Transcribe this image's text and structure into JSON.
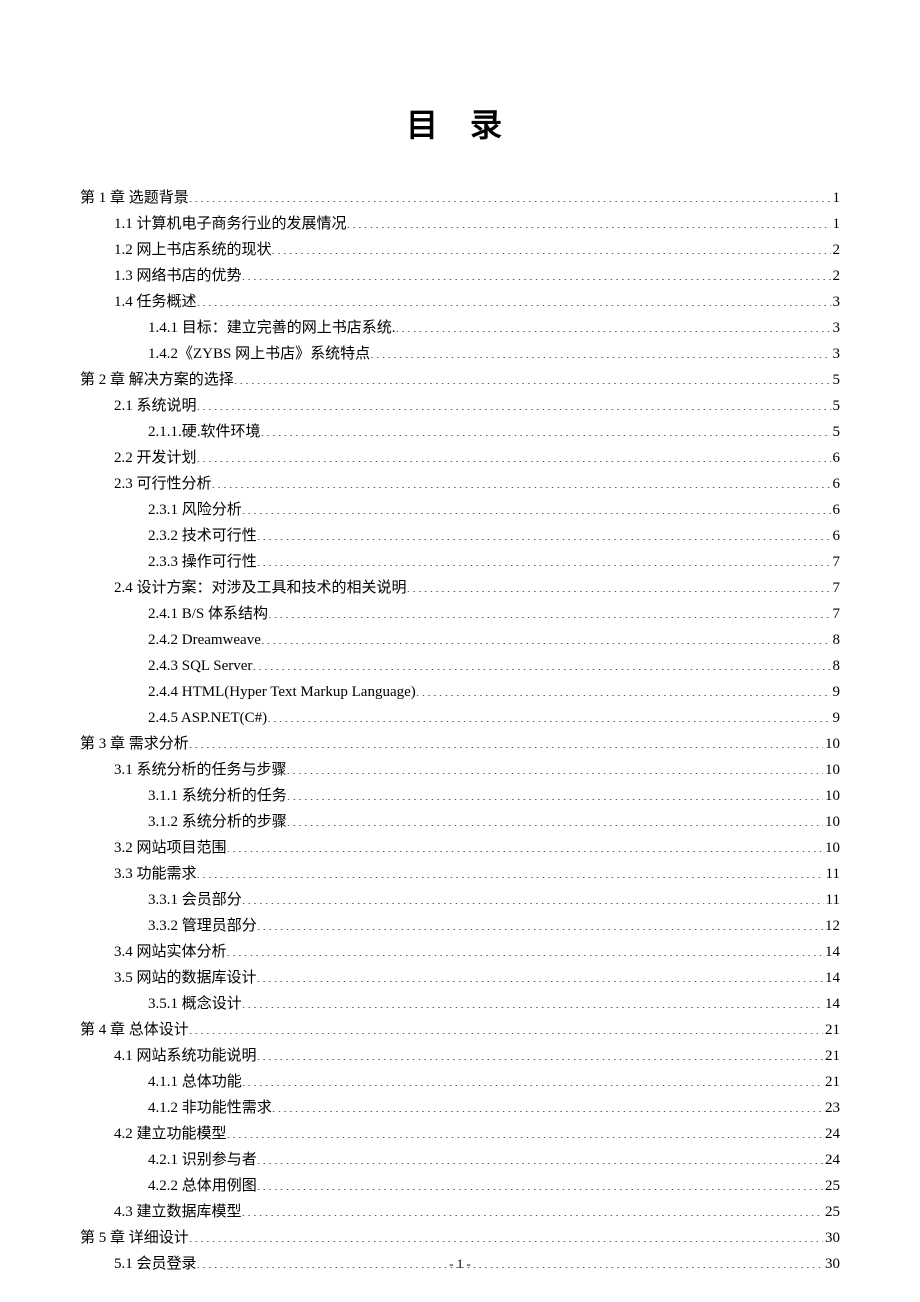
{
  "title": "目 录",
  "footer": "- 1 -",
  "entries": [
    {
      "indent": 0,
      "label": "第 1 章 选题背景",
      "page": "1"
    },
    {
      "indent": 1,
      "label": "1.1 计算机电子商务行业的发展情况",
      "page": "1"
    },
    {
      "indent": 1,
      "label": "1.2 网上书店系统的现状",
      "page": "2"
    },
    {
      "indent": 1,
      "label": "1.3 网络书店的优势",
      "page": "2"
    },
    {
      "indent": 1,
      "label": "1.4 任务概述",
      "page": "3"
    },
    {
      "indent": 2,
      "label": "1.4.1 目标：建立完善的网上书店系统.",
      "page": "3"
    },
    {
      "indent": 2,
      "label": "1.4.2《ZYBS 网上书店》系统特点",
      "page": "3"
    },
    {
      "indent": 0,
      "label": "第 2 章 解决方案的选择",
      "page": "5"
    },
    {
      "indent": 1,
      "label": "2.1 系统说明",
      "page": "5"
    },
    {
      "indent": 2,
      "label": "2.1.1.硬.软件环境",
      "page": "5"
    },
    {
      "indent": 1,
      "label": "2.2 开发计划",
      "page": "6"
    },
    {
      "indent": 1,
      "label": "2.3 可行性分析",
      "page": "6"
    },
    {
      "indent": 2,
      "label": "2.3.1 风险分析",
      "page": "6"
    },
    {
      "indent": 2,
      "label": "2.3.2 技术可行性",
      "page": "6"
    },
    {
      "indent": 2,
      "label": "2.3.3 操作可行性",
      "page": "7"
    },
    {
      "indent": 1,
      "label": "2.4 设计方案：对涉及工具和技术的相关说明",
      "page": "7"
    },
    {
      "indent": 2,
      "label": "2.4.1 B/S 体系结构",
      "page": "7"
    },
    {
      "indent": 2,
      "label": "2.4.2 Dreamweave",
      "page": "8"
    },
    {
      "indent": 2,
      "label": "2.4.3 SQL Server",
      "page": "8"
    },
    {
      "indent": 2,
      "label": "2.4.4 HTML(Hyper Text Markup Language)",
      "page": "9"
    },
    {
      "indent": 2,
      "label": "2.4.5 ASP.NET(C#)",
      "page": "9"
    },
    {
      "indent": 0,
      "label": "第 3 章 需求分析",
      "page": "10"
    },
    {
      "indent": 1,
      "label": "3.1 系统分析的任务与步骤",
      "page": "10"
    },
    {
      "indent": 2,
      "label": "3.1.1 系统分析的任务",
      "page": "10"
    },
    {
      "indent": 2,
      "label": "3.1.2 系统分析的步骤",
      "page": "10"
    },
    {
      "indent": 1,
      "label": "3.2 网站项目范围",
      "page": "10"
    },
    {
      "indent": 1,
      "label": "3.3 功能需求",
      "page": "11"
    },
    {
      "indent": 2,
      "label": "3.3.1 会员部分",
      "page": "11"
    },
    {
      "indent": 2,
      "label": "3.3.2 管理员部分",
      "page": "12"
    },
    {
      "indent": 1,
      "label": "3.4 网站实体分析",
      "page": "14"
    },
    {
      "indent": 1,
      "label": "3.5 网站的数据库设计",
      "page": "14"
    },
    {
      "indent": 2,
      "label": "3.5.1 概念设计",
      "page": "14"
    },
    {
      "indent": 0,
      "label": "第 4 章  总体设计",
      "page": "21"
    },
    {
      "indent": 1,
      "label": "4.1 网站系统功能说明",
      "page": "21"
    },
    {
      "indent": 2,
      "label": "4.1.1 总体功能",
      "page": "21"
    },
    {
      "indent": 2,
      "label": "4.1.2 非功能性需求",
      "page": "23"
    },
    {
      "indent": 1,
      "label": "4.2 建立功能模型",
      "page": "24"
    },
    {
      "indent": 2,
      "label": "4.2.1 识别参与者",
      "page": "24"
    },
    {
      "indent": 2,
      "label": "4.2.2 总体用例图",
      "page": "25"
    },
    {
      "indent": 1,
      "label": "4.3 建立数据库模型",
      "page": "25"
    },
    {
      "indent": 0,
      "label": "第 5 章 详细设计",
      "page": "30"
    },
    {
      "indent": 1,
      "label": "5.1 会员登录",
      "page": "30"
    }
  ]
}
